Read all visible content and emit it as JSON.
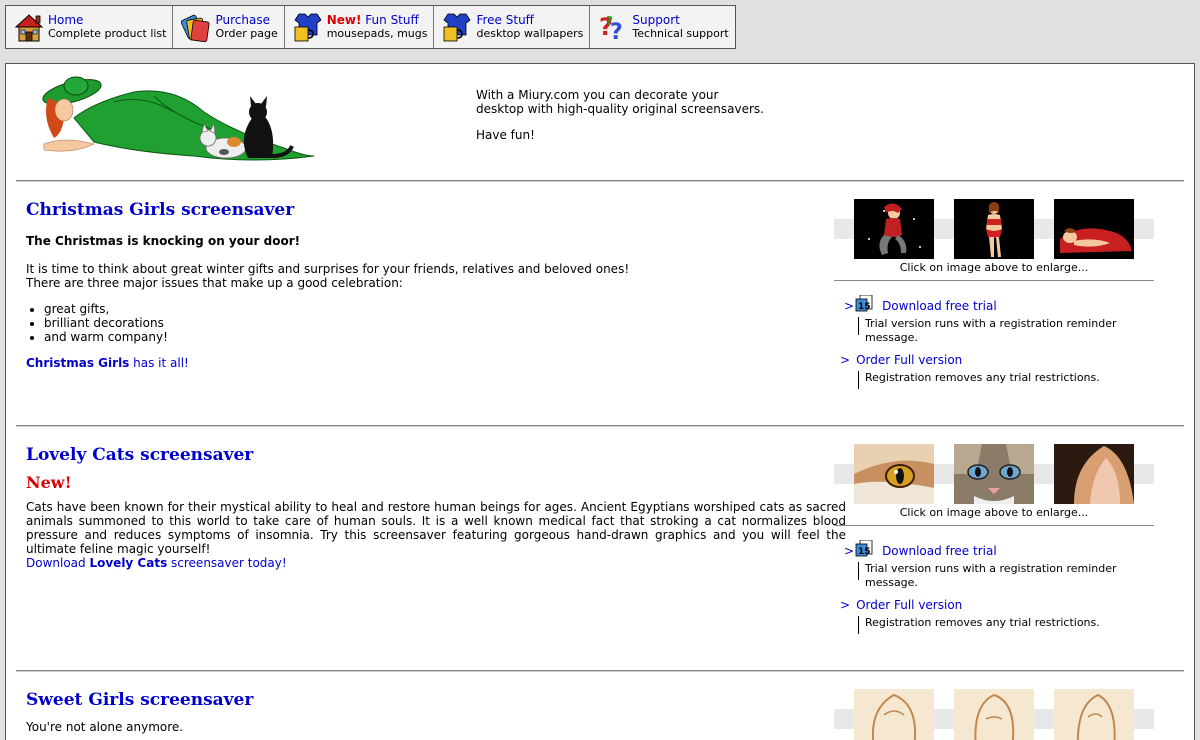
{
  "nav": [
    {
      "title": "Home",
      "sub": "Complete product list",
      "icon": "house-icon"
    },
    {
      "title": "Purchase",
      "sub": "Order page",
      "icon": "credit-cards-icon"
    },
    {
      "title_new": "New!",
      "title": "Fun Stuff",
      "sub": "mousepads, mugs",
      "icon": "tshirt-mug-icon"
    },
    {
      "title": "Free Stuff",
      "sub": "desktop wallpapers",
      "icon": "tshirt-mug-icon"
    },
    {
      "title": "Support",
      "sub": "Technical support",
      "icon": "question-marks-icon"
    }
  ],
  "intro": {
    "line1": "With a Miury.com you can decorate your",
    "line2": "desktop with high-quality original screensavers.",
    "line3": "Have fun!"
  },
  "common": {
    "enlarge": "Click on image above to enlarge...",
    "download": "Download free trial",
    "download_note": "Trial version runs with a registration reminder message.",
    "order": "Order Full version",
    "order_note": "Registration removes any trial restrictions.",
    "arrow": ">"
  },
  "products": [
    {
      "title": "Christmas Girls screensaver",
      "tagline": "The Christmas is knocking on your door!",
      "para1": "It is time to think about great winter gifts and surprises for your friends, relatives and beloved ones!",
      "para2": "There are three major issues that make up a good celebration:",
      "list": [
        "great gifts,",
        "brilliant decorations",
        "and warm company!"
      ],
      "link_bold": "Christmas Girls",
      "link_rest": " has it all!"
    },
    {
      "title": "Lovely Cats screensaver",
      "new": "New!",
      "para": "Cats have been known for their mystical ability to heal and restore human beings for ages. Ancient Egyptians worshiped cats as sacred animals summoned to this world to take care of human souls. It is a well known medical fact that stroking a cat normalizes blood pressure and reduces symptoms of insomnia. Try this screensaver featuring gorgeous hand-drawn graphics and you will feel the ultimate feline magic yourself!",
      "link_pre": "Download ",
      "link_bold": "Lovely Cats",
      "link_rest": " screensaver today!"
    },
    {
      "title": "Sweet Girls screensaver",
      "tagline": "You're not alone anymore."
    }
  ]
}
